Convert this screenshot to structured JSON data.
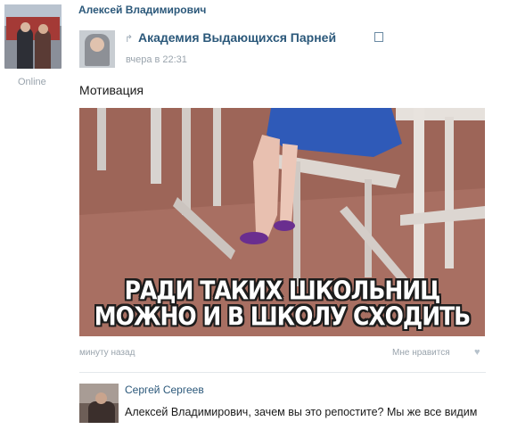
{
  "poster": {
    "name": "Алексей Владимирович",
    "status": "Online"
  },
  "shared": {
    "group_name": "Академия Выдающихся Парней",
    "time": "вчера в 22:31"
  },
  "post": {
    "text": "Мотивация",
    "caption_line1": "РАДИ ТАКИХ ШКОЛЬНИЦ",
    "caption_line2": "МОЖНО И В ШКОЛУ СХОДИТЬ",
    "time": "минуту назад",
    "like_label": "Мне нравится"
  },
  "comment": {
    "author": "Сергей Сергеев",
    "text": "Алексей Владимирович, зачем вы это репостите? Мы же все видим"
  },
  "colors": {
    "link": "#2b587a",
    "muted": "#9aa4ad"
  }
}
